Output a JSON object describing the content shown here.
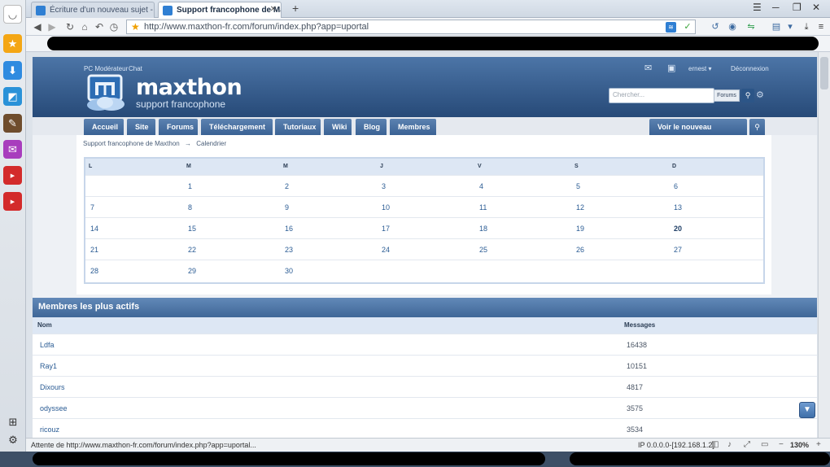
{
  "browser": {
    "tabs": [
      {
        "label": "Écriture d'un nouveau sujet - Suppo...",
        "active": false
      },
      {
        "label": "Support francophone de Maxth...",
        "active": true
      }
    ],
    "new_tab": "+",
    "url": "http://www.maxthon-fr.com/forum/index.php?app=uportal",
    "status_text": "Attente de http://www.maxthon-fr.com/forum/index.php?app=uportal...",
    "status_ip": "IP 0.0.0.0-[192.168.1.2]",
    "zoom": "130%"
  },
  "site": {
    "top_links": [
      "PC Modérateur",
      "Chat"
    ],
    "user": "ernest ▾",
    "logout": "Déconnexion",
    "logo_title": "maxthon",
    "logo_subtitle": "support francophone",
    "search_placeholder": "Chercher...",
    "search_scope": "Forums",
    "nav": [
      "Accueil",
      "Site",
      "Forums",
      "Téléchargement",
      "Tutoriaux",
      "Wiki",
      "Blog",
      "Membres"
    ],
    "new_content": "Voir le nouveau contenu",
    "breadcrumb": [
      "Support francophone de Maxthon",
      "→",
      "Calendrier"
    ]
  },
  "calendar": {
    "headers": [
      "L",
      "M",
      "M",
      "J",
      "V",
      "S",
      "D"
    ],
    "weeks": [
      [
        "",
        "1",
        "2",
        "3",
        "4",
        "5",
        "6"
      ],
      [
        "7",
        "8",
        "9",
        "10",
        "11",
        "12",
        "13"
      ],
      [
        "14",
        "15",
        "16",
        "17",
        "18",
        "19",
        "20"
      ],
      [
        "21",
        "22",
        "23",
        "24",
        "25",
        "26",
        "27"
      ],
      [
        "28",
        "29",
        "30",
        "",
        "",
        "",
        ""
      ]
    ],
    "today": "20"
  },
  "members": {
    "title": "Membres les plus actifs",
    "col_name": "Nom",
    "col_messages": "Messages",
    "rows": [
      {
        "name": "Ldfa",
        "messages": "16438"
      },
      {
        "name": "Ray1",
        "messages": "10151"
      },
      {
        "name": "Dixours",
        "messages": "4817"
      },
      {
        "name": "odyssee",
        "messages": "3575"
      },
      {
        "name": "ricouz",
        "messages": "3534"
      }
    ]
  }
}
